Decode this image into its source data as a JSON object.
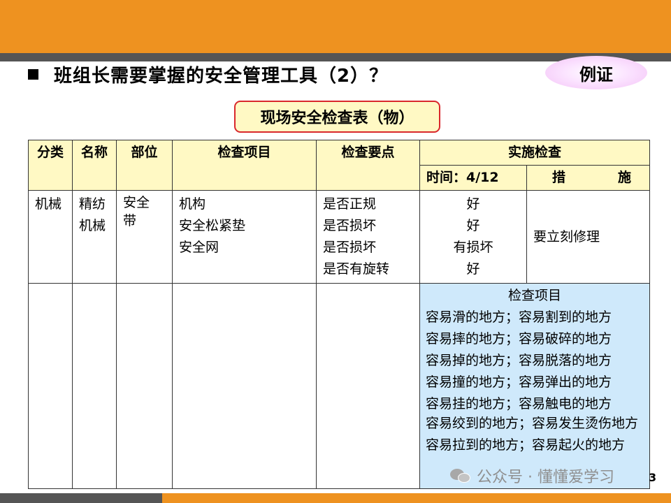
{
  "header": {
    "title": "班组长需要掌握的安全管理工具（2）？",
    "badge": "例证",
    "subtitle": "现场安全检查表（物）"
  },
  "table": {
    "headers": {
      "category": "分类",
      "name": "名称",
      "part": "部位",
      "items": "检查项目",
      "points": "检查要点",
      "implementation": "实施检查",
      "time": "时间：4/12",
      "measure_1": "措",
      "measure_2": "施"
    },
    "row": {
      "category": "机械",
      "name": [
        "精纺",
        "机械"
      ],
      "part": [
        "安全",
        "带"
      ],
      "items": [
        "机构",
        "安全松紧垫",
        "安全网"
      ],
      "points": [
        "是否正规",
        "是否损坏",
        "是否损坏",
        "是否有旋转"
      ],
      "results": [
        "好",
        "好",
        "有损坏",
        "好"
      ],
      "measure": "要立刻修理"
    },
    "note": {
      "heading": "检查项目",
      "lines": [
        "容易滑的地方；容易割到的地方",
        "容易摔的地方；容易破碎的地方",
        "容易掉的地方；容易脱落的地方",
        "容易撞的地方；容易弹出的地方",
        "容易挂的地方；容易触电的地方",
        "容易绞到的地方；容易发生烫伤地方",
        "容易拉到的地方；容易起火的地方"
      ]
    }
  },
  "footer": {
    "watermark": "公众号 · 懂懂爱学习",
    "page_number": "3"
  },
  "colors": {
    "brand_orange": "#ee9220",
    "stripe_gray": "#555555",
    "header_fill": "#fff9c4",
    "note_fill": "#cfe9fb",
    "subtitle_border": "#d9282c"
  }
}
